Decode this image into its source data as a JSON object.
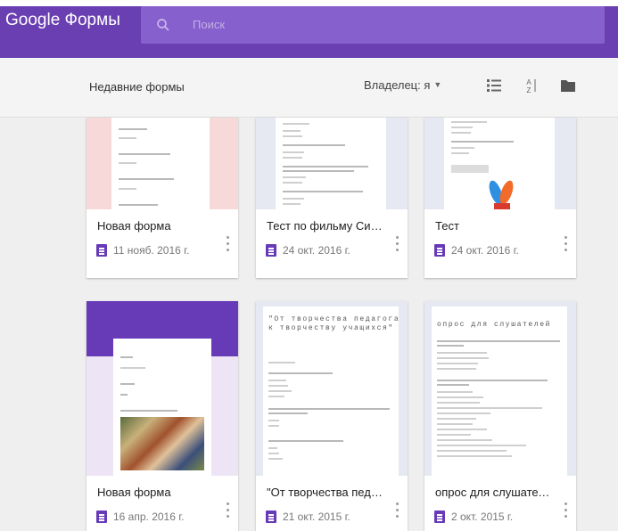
{
  "app": {
    "brand": "Google Формы",
    "search_placeholder": "Поиск"
  },
  "toolbar": {
    "title": "Недавние формы",
    "owner_label": "Владелец: я",
    "icons": [
      "list-view-icon",
      "sort-az-icon",
      "folder-icon"
    ]
  },
  "colors": {
    "appbar": "#6a3fb1",
    "searchbox": "#8660cc",
    "forms_purple": "#673ab7"
  },
  "forms": [
    {
      "title": "Новая форма",
      "date": "11 нояб. 2016 г."
    },
    {
      "title": "Тест по фильму Симфо...",
      "date": "24 окт. 2016 г."
    },
    {
      "title": "Тест",
      "date": "24 окт. 2016 г."
    },
    {
      "title": "Новая форма",
      "date": "16 апр. 2016 г."
    },
    {
      "title": "\"От творчества педагог...",
      "date": "21 окт. 2015 г."
    },
    {
      "title": "опрос для слушателей",
      "date": "2 окт. 2015 г."
    }
  ],
  "thumbnails": {
    "form5_heading": "\"От творчества педагога к творчеству учащихся\"",
    "form6_heading": "опрос для слушателей"
  }
}
